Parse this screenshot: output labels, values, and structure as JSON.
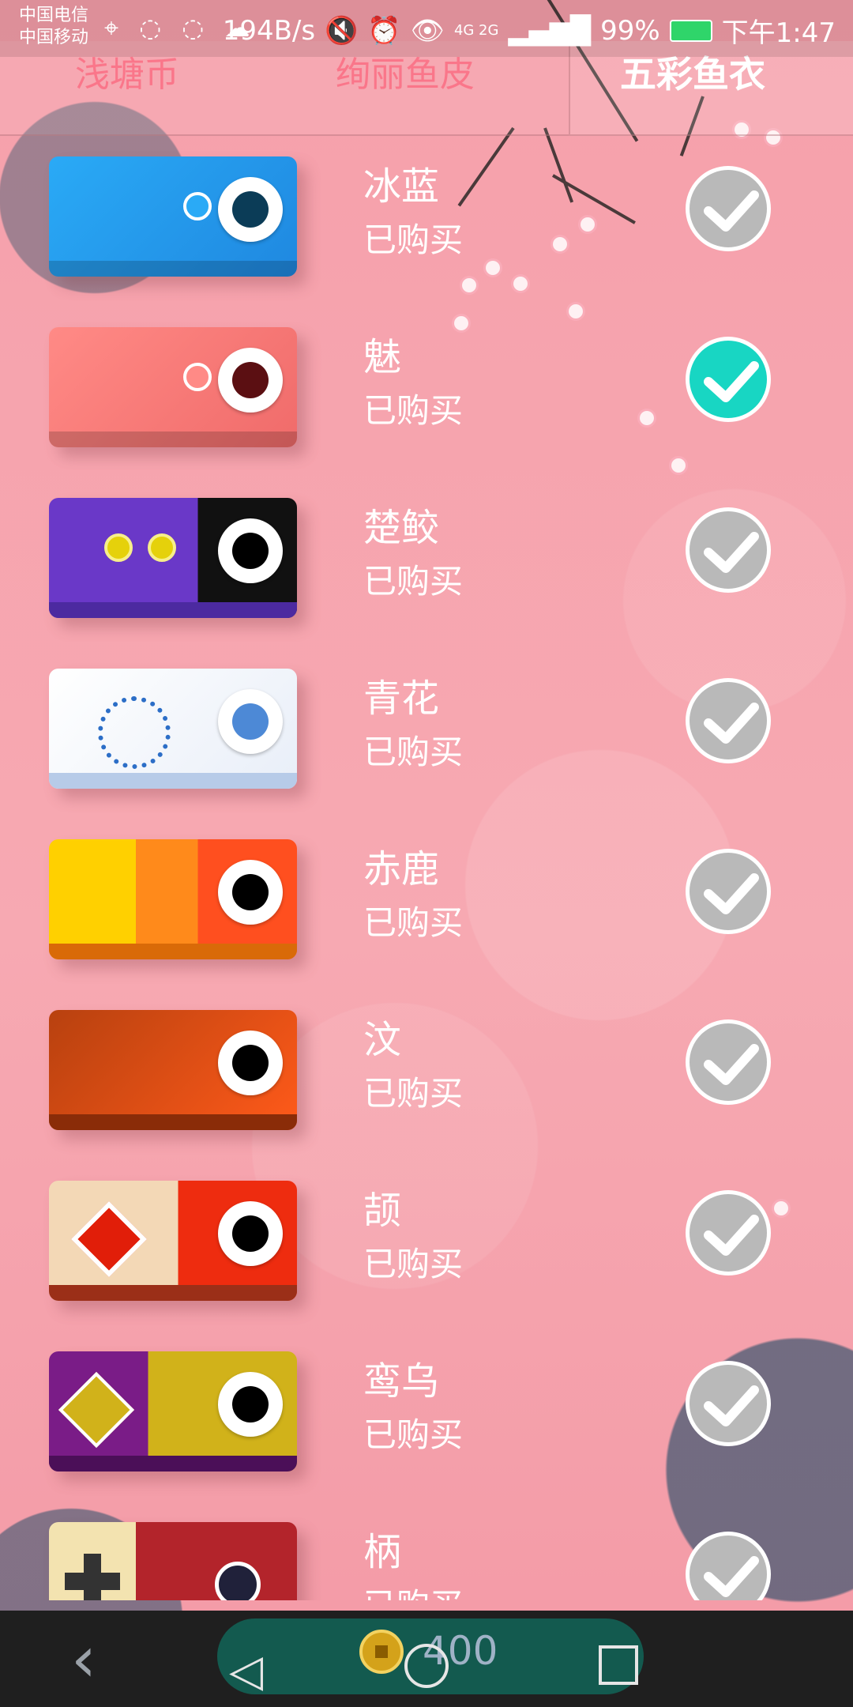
{
  "status_bar": {
    "carrier1": "中国电信",
    "carrier2": "中国移动",
    "speed": "194B/s",
    "network": "4G 2G",
    "battery_pct": "99%",
    "time": "下午1:47"
  },
  "header": {
    "tab_coins": "浅塘币",
    "tab_middle": "绚丽鱼皮",
    "tab_active": "五彩鱼衣"
  },
  "items": [
    {
      "name": "冰蓝",
      "status": "已购买",
      "checked": false
    },
    {
      "name": "魅",
      "status": "已购买",
      "checked": true
    },
    {
      "name": "楚鲛",
      "status": "已购买",
      "checked": false
    },
    {
      "name": "青花",
      "status": "已购买",
      "checked": false
    },
    {
      "name": "赤鹿",
      "status": "已购买",
      "checked": false
    },
    {
      "name": "汶",
      "status": "已购买",
      "checked": false
    },
    {
      "name": "颉",
      "status": "已购买",
      "checked": false
    },
    {
      "name": "鸾乌",
      "status": "已购买",
      "checked": false
    },
    {
      "name": "柄",
      "status": "已购买",
      "checked": false
    }
  ],
  "footer": {
    "coins": "400"
  },
  "colors": {
    "bg": "#f7a3ad",
    "check_active": "#18d6c3",
    "check_inactive": "#b9b9b9",
    "accent": "#ff4e6a"
  }
}
